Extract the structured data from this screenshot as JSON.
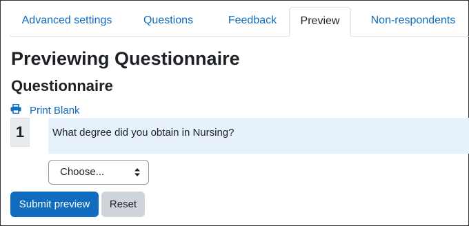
{
  "tabs": [
    {
      "label": "Advanced settings",
      "active": false
    },
    {
      "label": "Questions",
      "active": false
    },
    {
      "label": "Feedback",
      "active": false
    },
    {
      "label": "Preview",
      "active": true
    },
    {
      "label": "Non-respondents",
      "active": false
    }
  ],
  "page": {
    "heading": "Previewing Questionnaire",
    "subheading": "Questionnaire",
    "print_link": "Print Blank"
  },
  "question": {
    "number": "1",
    "text": "What degree did you obtain in Nursing?",
    "select_value": "Choose..."
  },
  "buttons": {
    "submit": "Submit preview",
    "reset": "Reset"
  },
  "colors": {
    "link": "#0f6cbf",
    "primary": "#0f6cbf",
    "question_bg": "#e7f1fb"
  },
  "icons": {
    "print": "print-icon",
    "select_arrows": "sort-arrows-icon"
  }
}
